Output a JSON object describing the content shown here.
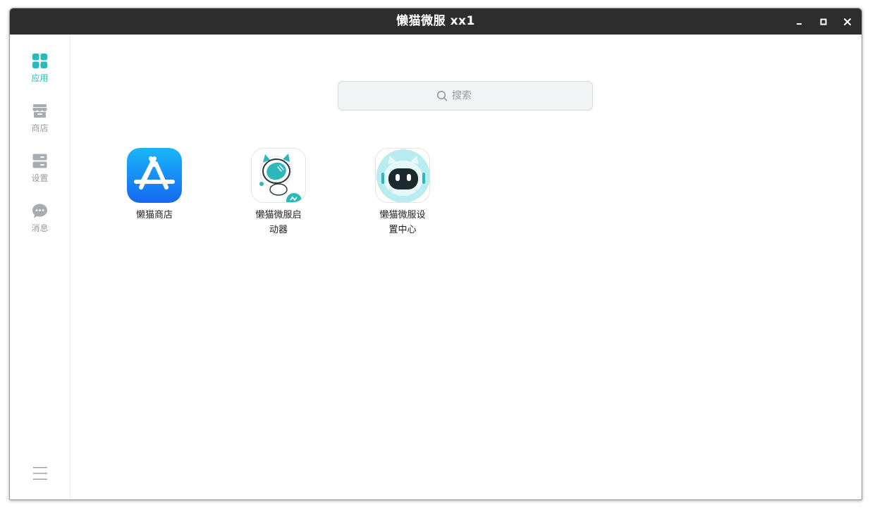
{
  "window": {
    "title": "懒猫微服  xx1",
    "controls": {
      "minimize_icon": "minimize-icon",
      "maximize_icon": "maximize-icon",
      "close_icon": "close-icon"
    }
  },
  "sidebar": {
    "items": [
      {
        "label": "应用",
        "icon": "grid-apps-icon",
        "active": true
      },
      {
        "label": "商店",
        "icon": "store-icon",
        "active": false
      },
      {
        "label": "设置",
        "icon": "settings-icon",
        "active": false
      },
      {
        "label": "消息",
        "icon": "message-icon",
        "active": false
      }
    ],
    "menu_icon": "hamburger-menu-icon"
  },
  "search": {
    "placeholder": "搜索",
    "value": ""
  },
  "apps": [
    {
      "label": "懒猫商店",
      "icon": "app-store-icon"
    },
    {
      "label": "懒猫微服启动器",
      "icon": "robot-cat-launcher-icon"
    },
    {
      "label": "懒猫微服设置中心",
      "icon": "robot-cat-settings-icon"
    }
  ],
  "colors": {
    "accent": "#2bb8b9",
    "titlebar": "#2d2d2d",
    "inactive": "#9a9a9a"
  }
}
